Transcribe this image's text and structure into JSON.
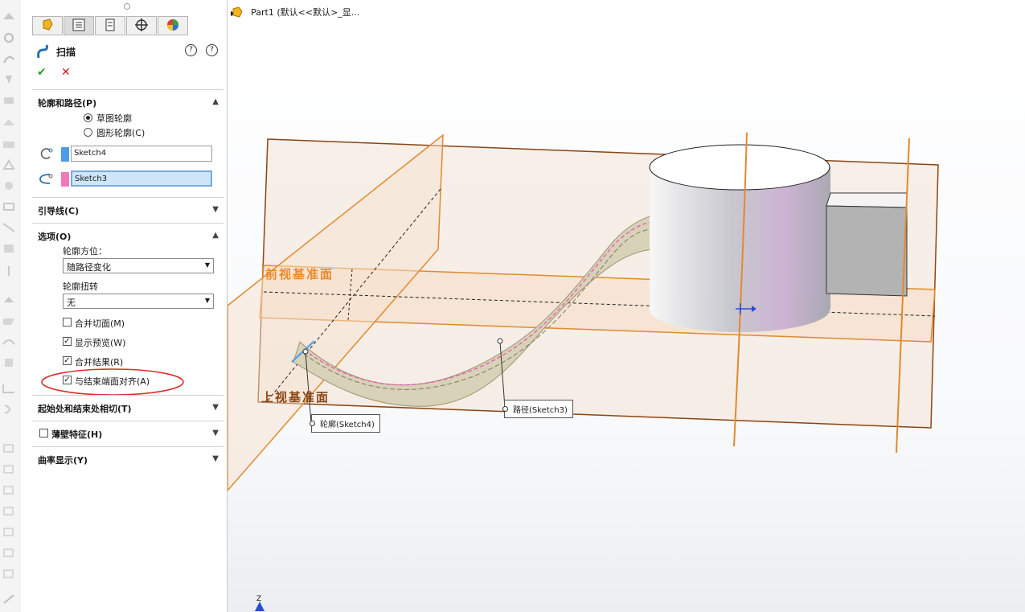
{
  "panel": {
    "tabs": [
      {
        "icon": "featuremanager-icon"
      },
      {
        "icon": "propertymanager-icon"
      },
      {
        "icon": "configurationmanager-icon"
      },
      {
        "icon": "dimxpert-icon"
      },
      {
        "icon": "display-manager-icon"
      }
    ],
    "feature_title": "扫描",
    "help_icons": [
      "?",
      "?"
    ],
    "sections": {
      "profile_path": {
        "label": "轮廓和路径(P)",
        "radio_sketch": "草图轮廓",
        "radio_circle": "圆形轮廓(C)",
        "profile_value": "Sketch4",
        "path_value": "Sketch3"
      },
      "guide": {
        "label": "引导线(C)"
      },
      "options": {
        "label": "选项(O)",
        "orientation_label": "轮廓方位：",
        "orientation_value": "随路径变化",
        "twist_label": "轮廓扭转",
        "twist_value": "无",
        "cb_merge_tangent": "合并切面(M)",
        "cb_show_preview": "显示预览(W)",
        "cb_merge_result": "合并结果(R)",
        "cb_align_end": "与结束端面对齐(A)"
      },
      "tangency": {
        "label": "起始处和结束处相切(T)"
      },
      "thin": {
        "label": "薄壁特征(H)"
      },
      "curvature": {
        "label": "曲率显示(Y)"
      }
    },
    "checked": {
      "merge_tangent": false,
      "show_preview": true,
      "merge_result": true,
      "align_end": true
    },
    "colors": {
      "profile_swatch": "#4a9be8",
      "path_swatch": "#f07ab8",
      "highlight_ellipse": "#d9302b"
    }
  },
  "viewport": {
    "breadcrumb": "Part1  (默认<<默认>_显...",
    "front_plane": "前视基准面",
    "top_plane": "上视基准面",
    "callout_profile": "轮廓(Sketch4)",
    "callout_path": "路径(Sketch3)",
    "axis_label": "Z",
    "colors": {
      "plane": "#e08a2e",
      "plane_fill": "#f5dcc4",
      "plane_edge": "#8b4513"
    }
  }
}
